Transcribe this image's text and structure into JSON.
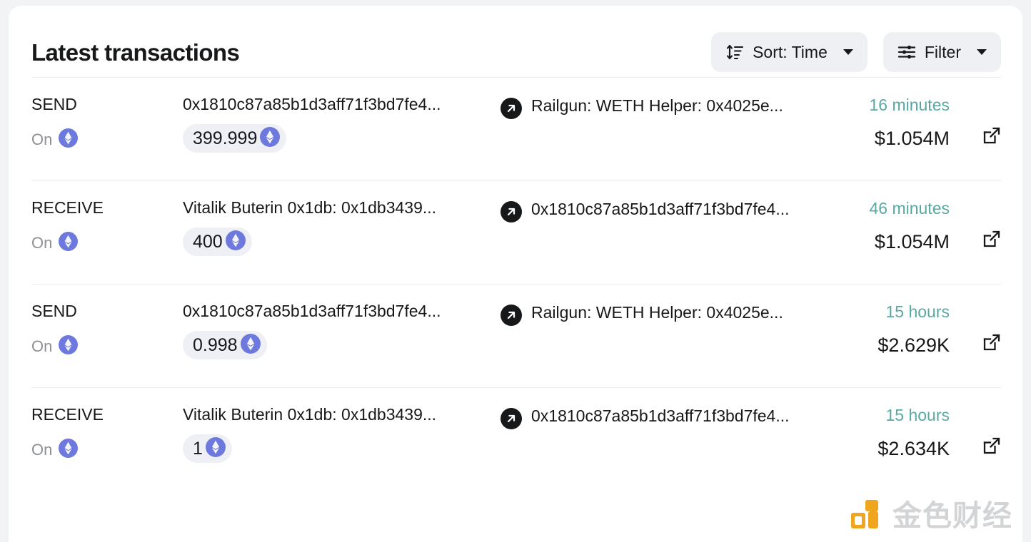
{
  "header": {
    "title": "Latest transactions",
    "sort_button": {
      "label": "Sort: Time",
      "icon": "sort-icon"
    },
    "filter_button": {
      "label": "Filter",
      "icon": "filter-sliders-icon"
    }
  },
  "colors": {
    "card_background": "#ffffff",
    "page_background": "#f2f3f5",
    "text_primary": "#17181a",
    "text_muted": "#8d9096",
    "time_accent": "#5aa8a2",
    "pill_background": "#eef0f5",
    "control_background": "#eff0f4",
    "eth_badge": "#6d79dd",
    "divider": "#ececef",
    "watermark_logo": "#f0a51e",
    "watermark_text": "#d3d4d6"
  },
  "transactions": [
    {
      "direction": "SEND",
      "on_label": "On",
      "chain_icon": "ethereum-icon",
      "source": "0x1810c87a85b1d3aff71f3bd7fe4...",
      "amount": "399.999",
      "amount_icon": "ethereum-icon",
      "arrow_icon": "arrow-up-right-circle-icon",
      "destination": "Railgun: WETH Helper: 0x4025e...",
      "time": "16 minutes",
      "usd_value": "$1.054M",
      "link_icon": "external-link-icon"
    },
    {
      "direction": "RECEIVE",
      "on_label": "On",
      "chain_icon": "ethereum-icon",
      "source": "Vitalik Buterin 0x1db: 0x1db3439...",
      "amount": "400",
      "amount_icon": "ethereum-icon",
      "arrow_icon": "arrow-up-right-circle-icon",
      "destination": "0x1810c87a85b1d3aff71f3bd7fe4...",
      "time": "46 minutes",
      "usd_value": "$1.054M",
      "link_icon": "external-link-icon"
    },
    {
      "direction": "SEND",
      "on_label": "On",
      "chain_icon": "ethereum-icon",
      "source": "0x1810c87a85b1d3aff71f3bd7fe4...",
      "amount": "0.998",
      "amount_icon": "ethereum-icon",
      "arrow_icon": "arrow-up-right-circle-icon",
      "destination": "Railgun: WETH Helper: 0x4025e...",
      "time": "15 hours",
      "usd_value": "$2.629K",
      "link_icon": "external-link-icon"
    },
    {
      "direction": "RECEIVE",
      "on_label": "On",
      "chain_icon": "ethereum-icon",
      "source": "Vitalik Buterin 0x1db: 0x1db3439...",
      "amount": "1",
      "amount_icon": "ethereum-icon",
      "arrow_icon": "arrow-up-right-circle-icon",
      "destination": "0x1810c87a85b1d3aff71f3bd7fe4...",
      "time": "15 hours",
      "usd_value": "$2.634K",
      "link_icon": "external-link-icon"
    }
  ],
  "watermark": {
    "text": "金色财经",
    "logo_icon": "jinse-logo-icon"
  }
}
